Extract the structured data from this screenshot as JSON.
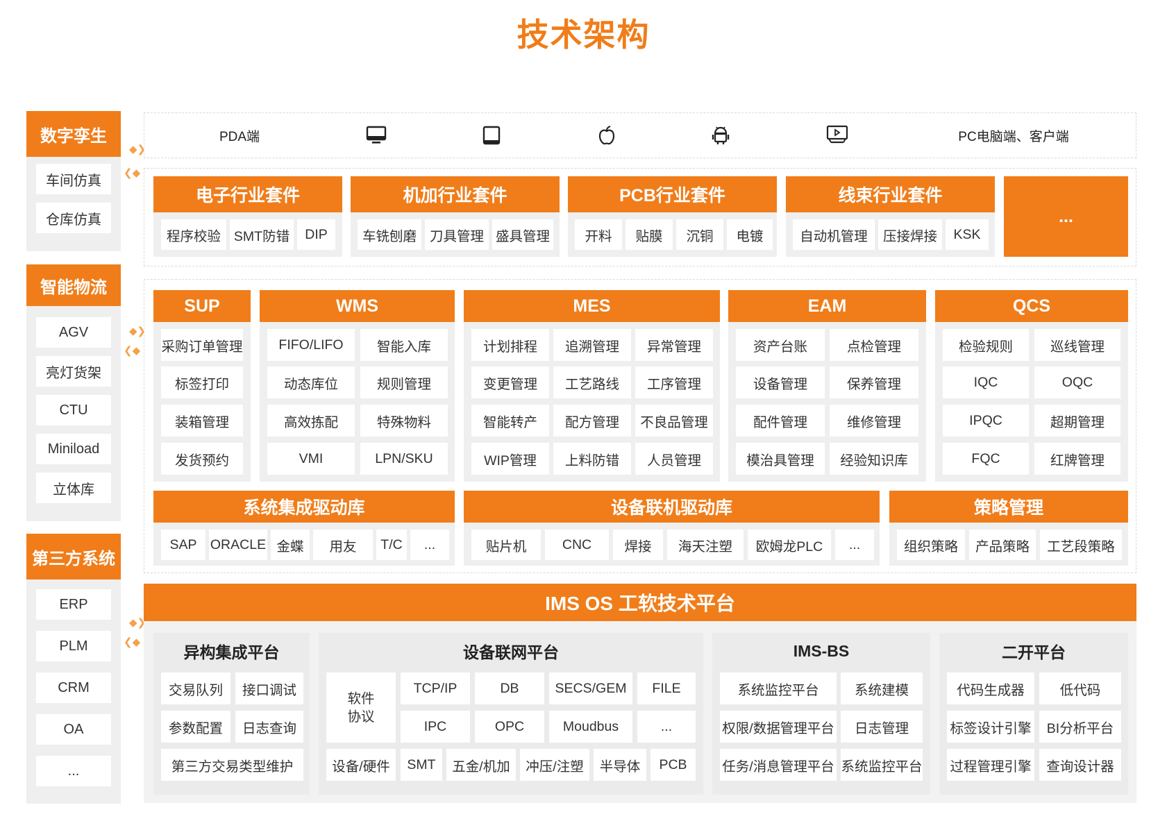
{
  "title": "技术架构",
  "left": {
    "groups": [
      {
        "head": "数字孪生",
        "items": [
          "车间仿真",
          "仓库仿真"
        ]
      },
      {
        "head": "智能物流",
        "items": [
          "AGV",
          "亮灯货架",
          "CTU",
          "Miniload",
          "立体库"
        ]
      },
      {
        "head": "第三方系统",
        "items": [
          "ERP",
          "PLM",
          "CRM",
          "OA",
          "..."
        ]
      }
    ]
  },
  "devices": {
    "pda_label": "PDA端",
    "pc_label": "PC电脑端、客户端",
    "icons": [
      "monitor-icon",
      "tablet-icon",
      "apple-icon",
      "android-icon",
      "screen-icon"
    ]
  },
  "kits": [
    {
      "head": "电子行业套件",
      "items": [
        "程序校验",
        "SMT防错",
        "DIP"
      ]
    },
    {
      "head": "机加行业套件",
      "items": [
        "车铣刨磨",
        "刀具管理",
        "盛具管理"
      ]
    },
    {
      "head": "PCB行业套件",
      "items": [
        "开料",
        "贴膜",
        "沉铜",
        "电镀"
      ]
    },
    {
      "head": "线束行业套件",
      "items": [
        "自动机管理",
        "压接焊接",
        "KSK"
      ]
    },
    {
      "head": "...",
      "items": []
    }
  ],
  "modules": [
    {
      "head": "SUP",
      "items": [
        "采购订单管理",
        "标签打印",
        "装箱管理",
        "发货预约"
      ]
    },
    {
      "head": "WMS",
      "items": [
        "FIFO/LIFO",
        "智能入库",
        "动态库位",
        "规则管理",
        "高效拣配",
        "特殊物料",
        "VMI",
        "LPN/SKU"
      ]
    },
    {
      "head": "MES",
      "items": [
        "计划排程",
        "追溯管理",
        "异常管理",
        "变更管理",
        "工艺路线",
        "工序管理",
        "智能转产",
        "配方管理",
        "不良品管理",
        "WIP管理",
        "上料防错",
        "人员管理"
      ]
    },
    {
      "head": "EAM",
      "items": [
        "资产台账",
        "点检管理",
        "设备管理",
        "保养管理",
        "配件管理",
        "维修管理",
        "模治具管理",
        "经验知识库"
      ]
    },
    {
      "head": "QCS",
      "items": [
        "检验规则",
        "巡线管理",
        "IQC",
        "OQC",
        "IPQC",
        "超期管理",
        "FQC",
        "红牌管理"
      ]
    }
  ],
  "drivers": [
    {
      "head": "系统集成驱动库",
      "items": [
        "SAP",
        "ORACLE",
        "金蝶",
        "用友",
        "T/C",
        "..."
      ]
    },
    {
      "head": "设备联机驱动库",
      "items": [
        "贴片机",
        "CNC",
        "焊接",
        "海天注塑",
        "欧姆龙PLC",
        "..."
      ]
    },
    {
      "head": "策略管理",
      "items": [
        "组织策略",
        "产品策略",
        "工艺段策略"
      ]
    }
  ],
  "platform": {
    "head": "IMS OS 工软技术平台",
    "heterogeneous": {
      "title": "异构集成平台",
      "items": [
        "交易队列",
        "接口调试",
        "参数配置",
        "日志查询",
        "第三方交易类型维护"
      ]
    },
    "iot": {
      "title": "设备联网平台",
      "software_label": "软件\n协议",
      "protocols": [
        "TCP/IP",
        "DB",
        "SECS/GEM",
        "FILE",
        "IPC",
        "OPC",
        "Moudbus",
        "..."
      ],
      "hardware": [
        "设备/硬件",
        "SMT",
        "五金/机加",
        "冲压/注塑",
        "半导体",
        "PCB"
      ]
    },
    "imsbs": {
      "title": "IMS-BS",
      "items": [
        "系统监控平台",
        "系统建模",
        "权限/数据管理平台",
        "日志管理",
        "任务/消息管理平台",
        "系统监控平台"
      ]
    },
    "dev": {
      "title": "二开平台",
      "items": [
        "代码生成器",
        "低代码",
        "标签设计引擎",
        "BI分析平台",
        "过程管理引擎",
        "查询设计器"
      ]
    }
  },
  "colors": {
    "accent": "#f07d1a",
    "panel": "#efefef"
  }
}
